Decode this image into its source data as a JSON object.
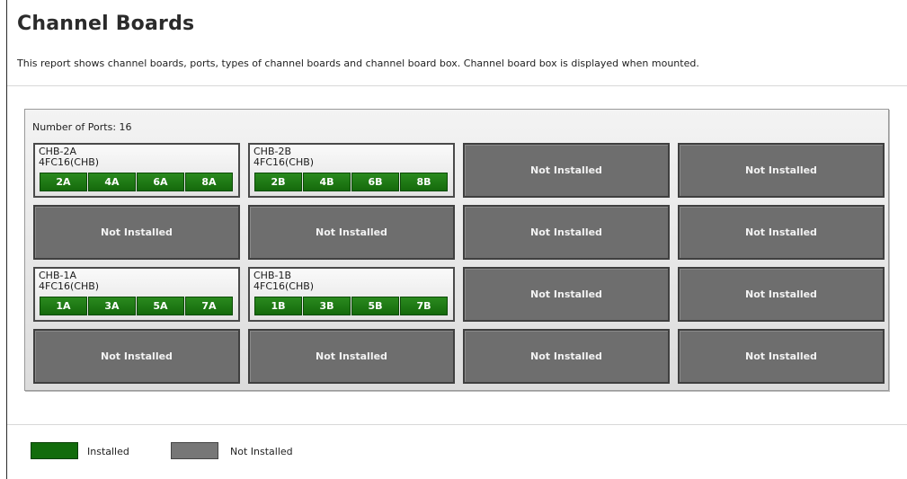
{
  "page": {
    "title": "Channel Boards",
    "description": "This report shows channel boards, ports, types of channel boards and channel board box. Channel board box is displayed when mounted."
  },
  "panel": {
    "ports_label": "Number of Ports: 16"
  },
  "boards": {
    "chb_2a": {
      "name": "CHB-2A",
      "type": "4FC16(CHB)",
      "ports": [
        "2A",
        "4A",
        "6A",
        "8A"
      ]
    },
    "chb_2b": {
      "name": "CHB-2B",
      "type": "4FC16(CHB)",
      "ports": [
        "2B",
        "4B",
        "6B",
        "8B"
      ]
    },
    "chb_1a": {
      "name": "CHB-1A",
      "type": "4FC16(CHB)",
      "ports": [
        "1A",
        "3A",
        "5A",
        "7A"
      ]
    },
    "chb_1b": {
      "name": "CHB-1B",
      "type": "4FC16(CHB)",
      "ports": [
        "1B",
        "3B",
        "5B",
        "7B"
      ]
    }
  },
  "empty_slot_label": "Not Installed",
  "legend": {
    "installed_label": "Installed",
    "not_installed_label": "Not Installed",
    "installed_color": "#126c0c",
    "not_installed_color": "#777777"
  }
}
